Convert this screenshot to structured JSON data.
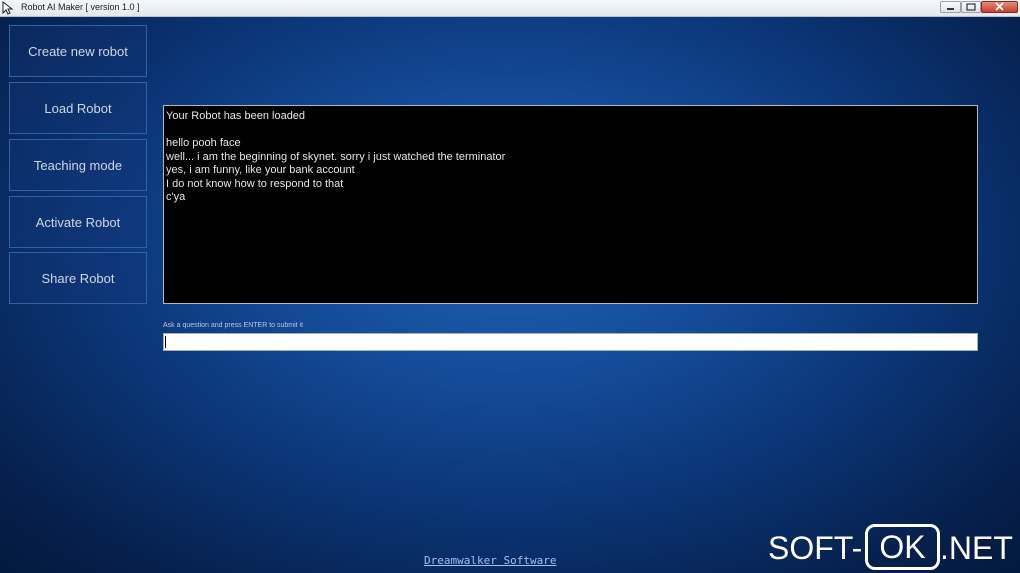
{
  "window": {
    "title": "Robot AI Maker [ version 1.0 ]"
  },
  "menu": {
    "create": "Create new robot",
    "load": "Load Robot",
    "teach": "Teaching mode",
    "activate": "Activate Robot",
    "share": "Share Robot"
  },
  "output": {
    "lines": [
      "Your Robot has been loaded",
      "",
      "hello pooh face",
      "well... i am the beginning of skynet. sorry i just watched the terminator",
      "yes, i am funny, like your bank account",
      "I do not know how to respond to that",
      "c'ya"
    ]
  },
  "input": {
    "label": "Ask a question and press ENTER to submit it",
    "value": ""
  },
  "footer": {
    "link": "Dreamwalker Software"
  },
  "watermark": {
    "left": "SOFT-",
    "box": "OK",
    "right": ".NET"
  },
  "colors": {
    "background": "#0b3576",
    "button_border": "#2f62a7",
    "output_bg": "#000000",
    "link": "#9ec3f2"
  },
  "icons": {
    "app": "robot-app-icon",
    "minimize": "minimize-icon",
    "maximize": "maximize-icon",
    "close": "close-icon"
  }
}
